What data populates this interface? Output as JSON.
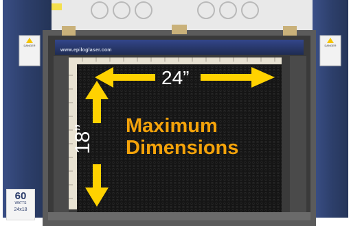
{
  "photo": {
    "url_strip": "www.epiloglaser.com",
    "width_label": "24”",
    "height_label": "18”",
    "headline_line1": "Maximum",
    "headline_line2": "Dimensions",
    "badge": {
      "watts": "60",
      "unit": "WATTS",
      "size": "24x18"
    },
    "warning_left": "DANGER",
    "warning_right": "DANGER"
  },
  "colors": {
    "frame_blue": "#2d3f6b",
    "bed_black": "#141414",
    "arrow_yellow": "#ffd200",
    "headline_orange": "#f5a30a"
  }
}
